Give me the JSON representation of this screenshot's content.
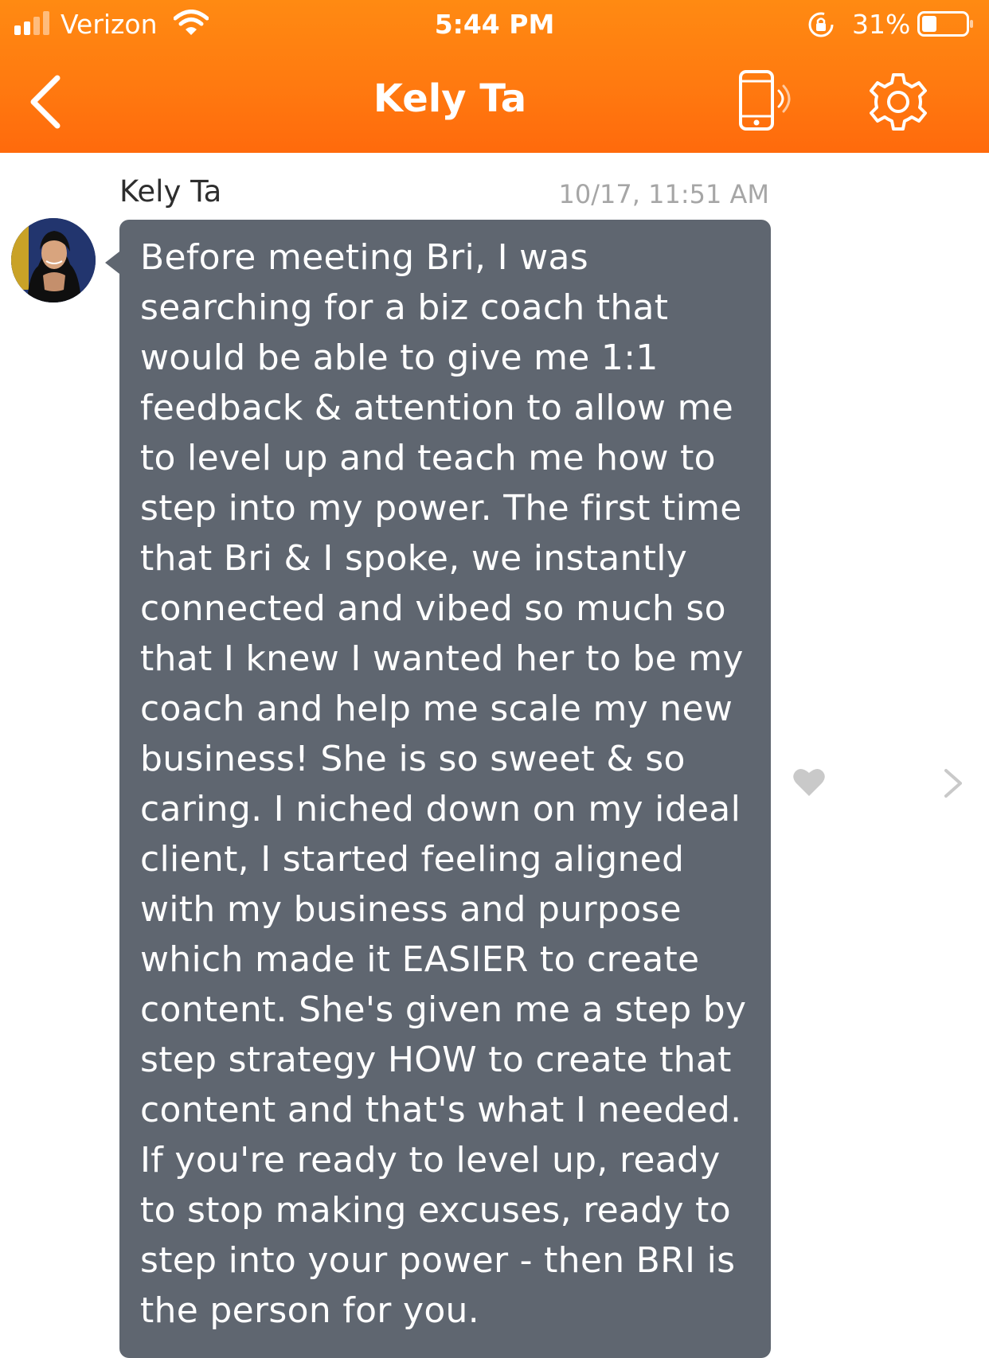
{
  "status_bar": {
    "carrier": "Verizon",
    "time": "5:44 PM",
    "battery_percent": "31%",
    "battery_level": 0.31,
    "signal_bars_active": 2,
    "signal_bars_total": 4,
    "icons": [
      "signal-icon",
      "wifi-icon",
      "rotation-lock-icon",
      "battery-icon"
    ]
  },
  "nav": {
    "title": "Kely Ta",
    "back_icon": "chevron-left-icon",
    "call_icon": "phone-ringing-icon",
    "settings_icon": "gear-icon"
  },
  "message": {
    "sender": "Kely Ta",
    "timestamp": "10/17, 11:51 AM",
    "text": "Before meeting Bri, I was\nsearching for a biz coach that\nwould be able to give me 1:1\nfeedback & attention to allow me\nto level up and teach me how to\nstep into my power. The first time\nthat Bri & I spoke, we instantly\nconnected and vibed so much so\nthat I knew I wanted her to be my\ncoach and help me scale my new\nbusiness! She is so sweet & so\ncaring. I niched down on my ideal\nclient, I started feeling aligned\nwith my business and purpose\nwhich made it EASIER to create\ncontent. She's given me a step by\nstep strategy HOW to create that\ncontent and that's what I needed.\nIf you're ready to level up, ready\nto stop making excuses, ready to\nstep into your power - then BRI is\nthe person for you.",
    "like_icon": "heart-icon",
    "more_icon": "chevron-right-icon"
  },
  "colors": {
    "header_orange": "#ff7a10",
    "bubble_gray": "#5f6670",
    "timestamp_gray": "#a6a6a6",
    "icon_gray": "#c9c9c9"
  }
}
